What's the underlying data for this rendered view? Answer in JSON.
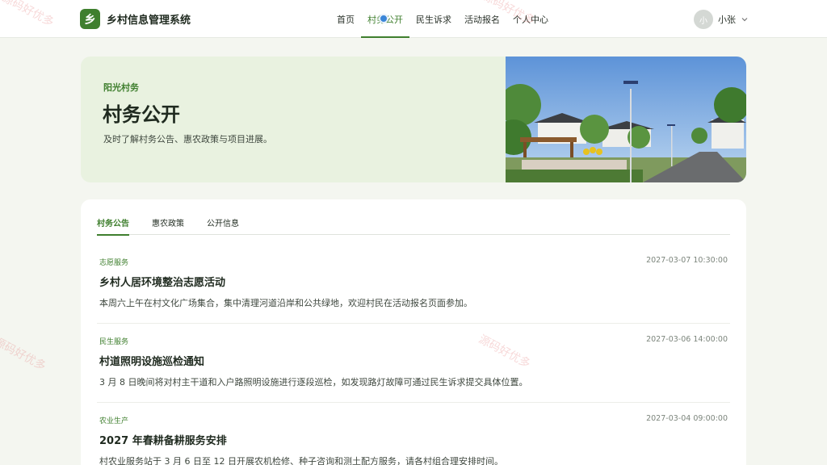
{
  "brand": {
    "logo_char": "乡",
    "name": "乡村信息管理系统"
  },
  "nav": {
    "items": [
      {
        "label": "首页"
      },
      {
        "label": "村务公开",
        "active": true
      },
      {
        "label": "民生诉求"
      },
      {
        "label": "活动报名"
      },
      {
        "label": "个人中心"
      }
    ]
  },
  "user": {
    "avatar_char": "小",
    "name": "小张"
  },
  "hero": {
    "kicker": "阳光村务",
    "title": "村务公开",
    "subtitle": "及时了解村务公告、惠农政策与项目进展。"
  },
  "tabs": [
    {
      "label": "村务公告",
      "active": true
    },
    {
      "label": "惠农政策"
    },
    {
      "label": "公开信息"
    }
  ],
  "news": [
    {
      "category": "志愿服务",
      "time": "2027-03-07 10:30:00",
      "title": "乡村人居环境整治志愿活动",
      "desc": "本周六上午在村文化广场集合，集中清理河道沿岸和公共绿地，欢迎村民在活动报名页面参加。"
    },
    {
      "category": "民生服务",
      "time": "2027-03-06 14:00:00",
      "title": "村道照明设施巡检通知",
      "desc": "3 月 8 日晚间将对村主干道和入户路照明设施进行逐段巡检，如发现路灯故障可通过民生诉求提交具体位置。"
    },
    {
      "category": "农业生产",
      "time": "2027-03-04 09:00:00",
      "title": "2027 年春耕备耕服务安排",
      "desc": "村农业服务站于 3 月 6 日至 12 日开展农机检修、种子咨询和测土配方服务，请各村组合理安排时间。"
    }
  ],
  "watermark": "源码好优多",
  "colors": {
    "accent": "#3f7f2e",
    "hero_bg": "#e9f2e0",
    "page_bg": "#f4f6f0"
  }
}
